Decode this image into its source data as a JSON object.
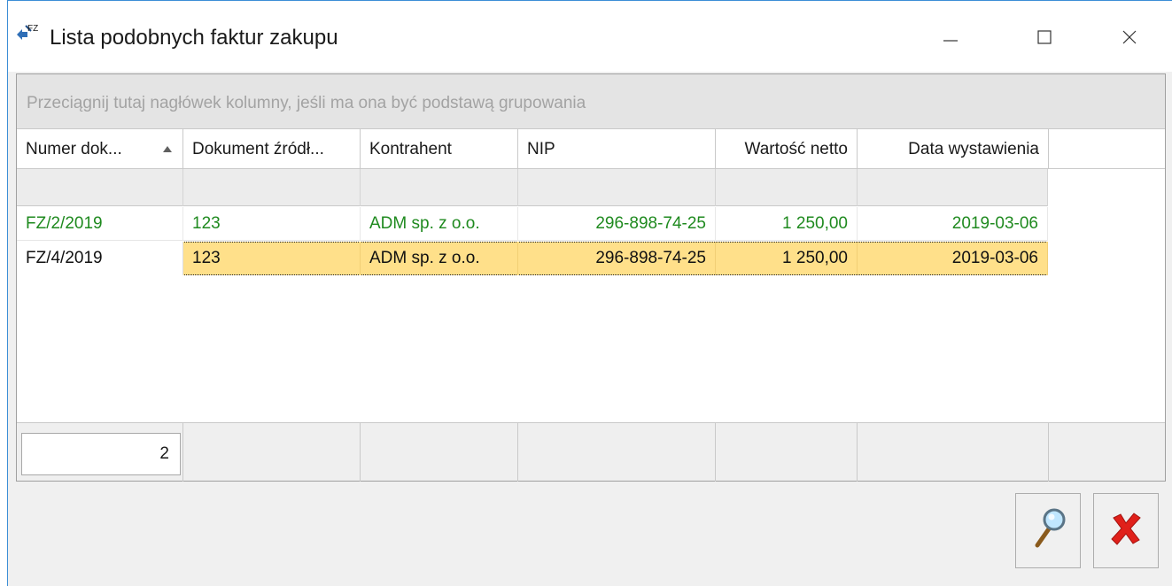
{
  "window": {
    "title": "Lista podobnych faktur zakupu",
    "icon": "fz-document-icon",
    "controls": [
      "minimize-icon",
      "maximize-icon",
      "close-icon"
    ]
  },
  "grid": {
    "group_hint": "Przeciągnij tutaj nagłówek kolumny, jeśli ma ona być podstawą grupowania",
    "columns": [
      "Numer dok...",
      "Dokument źródł...",
      "Kontrahent",
      "NIP",
      "Wartość netto",
      "Data wystawienia"
    ],
    "sort": {
      "column": "Numer dok...",
      "direction": "ascending"
    },
    "rows": [
      {
        "numer": "FZ/2/2019",
        "dokument": "123",
        "kontrahent": "ADM sp. z o.o.",
        "nip": "296-898-74-25",
        "wartosc": "1 250,00",
        "data": "2019-03-06",
        "state": "normal"
      },
      {
        "numer": "FZ/4/2019",
        "dokument": "123",
        "kontrahent": "ADM sp. z o.o.",
        "nip": "296-898-74-25",
        "wartosc": "1 250,00",
        "data": "2019-03-06",
        "state": "selected"
      }
    ],
    "footer_count": "2"
  },
  "buttons": {
    "preview": "magnifier-icon",
    "close": "red-x-icon"
  },
  "colors": {
    "row_text_green": "#1f8a1f",
    "selected_row": "#ffe08a",
    "close_red": "#e0201a"
  }
}
